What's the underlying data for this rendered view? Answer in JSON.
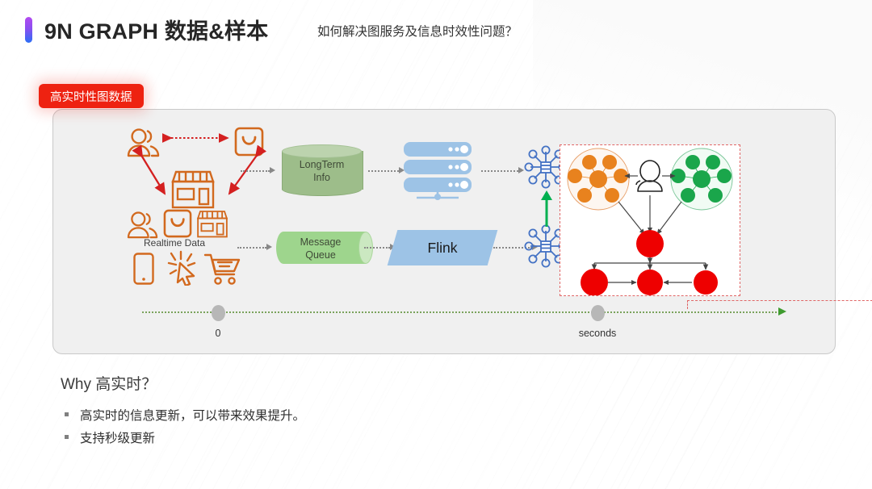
{
  "header": {
    "title": "9N GRAPH 数据&样本",
    "subtitle": "如何解决图服务及信息时效性问题？",
    "accent_top": "#b34af0",
    "accent_bottom": "#2b6ef5"
  },
  "badge": {
    "label": "高实时性图数据",
    "color": "#ee2211"
  },
  "diagram": {
    "row_top": {
      "source_icons": [
        "users-icon",
        "shopping-bag-icon",
        "store-icon"
      ],
      "store_label": "",
      "storage": {
        "line1": "LongTerm",
        "line2": "Info",
        "color": "#9dbd8a"
      },
      "servers": {
        "name": "server-stack-icon",
        "color": "#9dc3e6",
        "units": 3
      },
      "graph_node": {
        "name": "graph-network-icon",
        "color": "#4472c4"
      }
    },
    "row_bottom": {
      "source_label": "Realtime Data",
      "source_icons_top": [
        "users-icon",
        "shopping-bag-icon",
        "store-icon"
      ],
      "source_icons_bottom": [
        "mobile-icon",
        "click-cursor-icon",
        "shopping-cart-icon"
      ],
      "queue": {
        "line1": "Message",
        "line2": "Queue",
        "color": "#9ed58d"
      },
      "processor": {
        "label": "Flink",
        "color": "#9dc3e6"
      },
      "graph_node": {
        "name": "graph-network-icon",
        "color": "#4472c4"
      }
    },
    "uplink_arrow_color": "#00b050",
    "knowledge_graph": {
      "name": "knowledge-graph-thumbnail",
      "border_color": "#e06666",
      "clusters": [
        {
          "name": "orange-cluster",
          "color": "#e8821e"
        },
        {
          "name": "green-cluster",
          "color": "#1aa64b"
        },
        {
          "name": "red-cluster",
          "color": "#ee0000"
        }
      ],
      "person_icon": "person-icon"
    },
    "timeline": {
      "start_label": "0",
      "end_label": "seconds",
      "line_color": "#7aa35c",
      "arrow_color": "#3f9b2f"
    }
  },
  "footer": {
    "heading": "Why 高实时？",
    "bullets": [
      "高实时的信息更新，可以带来效果提升。",
      "支持秒级更新"
    ]
  }
}
